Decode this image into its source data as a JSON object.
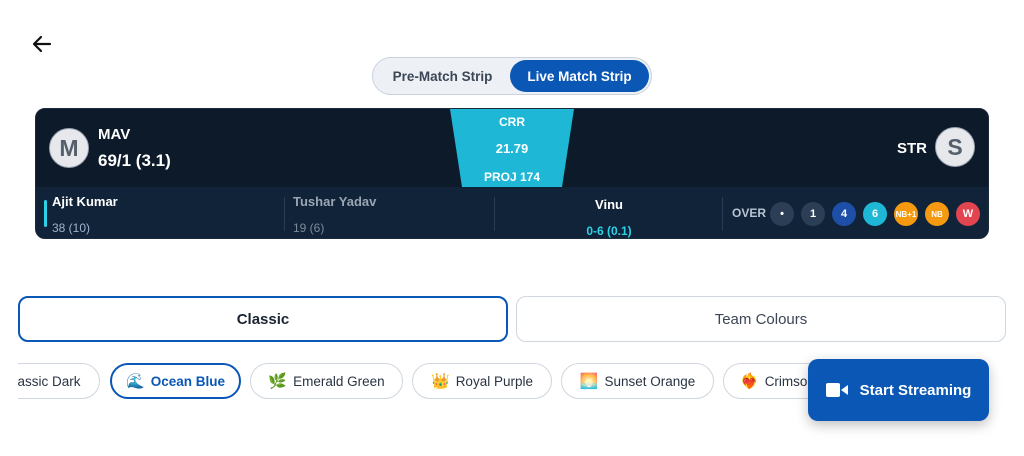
{
  "toggle": {
    "pre_match": "Pre-Match Strip",
    "live_match": "Live Match Strip"
  },
  "strip": {
    "left_team": {
      "initial": "M",
      "name": "MAV",
      "score": "69/1 (3.1)"
    },
    "right_team": {
      "initial": "S",
      "name": "STR"
    },
    "crr": {
      "label": "CRR",
      "value": "21.79",
      "projection": "PROJ 174"
    },
    "batters": [
      {
        "name": "Ajit Kumar",
        "runs": "38 (10)"
      },
      {
        "name": "Tushar Yadav",
        "runs": "19 (6)"
      }
    ],
    "bowler": {
      "name": "Vinu",
      "figures": "0-6 (0.1)"
    },
    "over": {
      "label": "OVER",
      "balls": [
        {
          "text": "•",
          "color": "#2c3e55"
        },
        {
          "text": "1",
          "color": "#2c3e55"
        },
        {
          "text": "4",
          "color": "#1d4fa8"
        },
        {
          "text": "6",
          "color": "#1fb7d6"
        },
        {
          "text": "NB+1",
          "color": "#f59a10"
        },
        {
          "text": "NB",
          "color": "#f59a10"
        },
        {
          "text": "W",
          "color": "#e2454f"
        }
      ]
    },
    "colors": {
      "background": "#0c1a2a",
      "accent": "#2bd2e8"
    }
  },
  "tabs": {
    "classic": "Classic",
    "team_colours": "Team Colours"
  },
  "themes": [
    {
      "emoji": "",
      "label": "assic Dark"
    },
    {
      "emoji": "🌊",
      "label": "Ocean Blue"
    },
    {
      "emoji": "🌿",
      "label": "Emerald Green"
    },
    {
      "emoji": "👑",
      "label": "Royal Purple"
    },
    {
      "emoji": "🌅",
      "label": "Sunset Orange"
    },
    {
      "emoji": "❤️‍🔥",
      "label": "Crimso"
    }
  ],
  "stream_button": {
    "label": "Start Streaming",
    "color": "#0a57b5"
  }
}
